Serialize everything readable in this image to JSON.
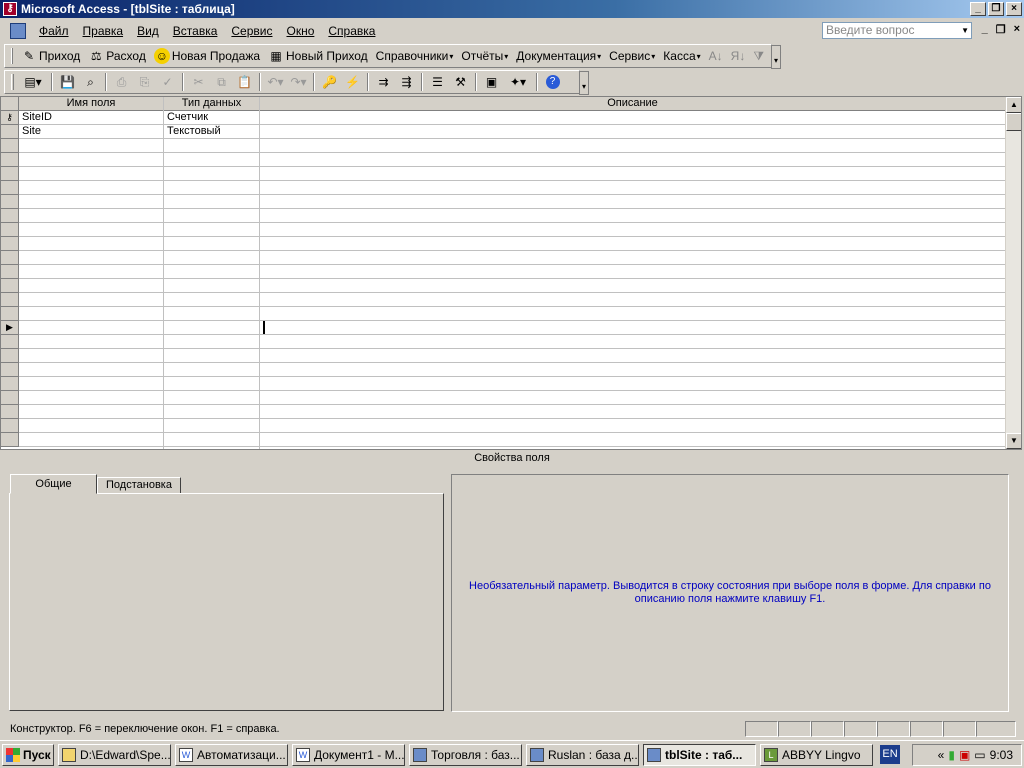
{
  "window": {
    "title": "Microsoft Access - [tblSite : таблица]",
    "app_icon": "access-key-icon"
  },
  "menubar": {
    "items": [
      "Файл",
      "Правка",
      "Вид",
      "Вставка",
      "Сервис",
      "Окно",
      "Справка"
    ],
    "ask_placeholder": "Введите вопрос"
  },
  "custom_toolbar": {
    "items": [
      {
        "label": "Приход",
        "icon": "receipt-icon"
      },
      {
        "label": "Расход",
        "icon": "scales-icon"
      },
      {
        "label": "Новая Продажа",
        "icon": "smiley-icon"
      },
      {
        "label": "Новый Приход",
        "icon": "form-icon"
      },
      {
        "label": "Справочники",
        "dropdown": true
      },
      {
        "label": "Отчёты",
        "dropdown": true
      },
      {
        "label": "Документация",
        "dropdown": true
      },
      {
        "label": "Сервис",
        "dropdown": true
      },
      {
        "label": "Касса",
        "dropdown": true
      }
    ]
  },
  "grid": {
    "headers": {
      "field_name": "Имя поля",
      "data_type": "Тип данных",
      "description": "Описание"
    },
    "rows": [
      {
        "name": "SiteID",
        "type": "Счетчик",
        "primary_key": true
      },
      {
        "name": "Site",
        "type": "Текстовый",
        "primary_key": false
      }
    ]
  },
  "properties": {
    "caption": "Свойства поля",
    "tabs": [
      "Общие",
      "Подстановка"
    ],
    "active_tab": "Общие",
    "help_text": "Необязательный параметр.  Выводится в строку состояния при выборе поля в форме.  Для справки по описанию поля нажмите клавишу F1."
  },
  "status_bar": {
    "text": "Конструктор.  F6 = переключение окон.  F1 = справка."
  },
  "taskbar": {
    "start_label": "Пуск",
    "tasks": [
      {
        "label": "D:\\Edward\\Spe...",
        "icon": "folder-icon"
      },
      {
        "label": "Автоматизаци...",
        "icon": "word-icon"
      },
      {
        "label": "Документ1 - М...",
        "icon": "word-icon"
      },
      {
        "label": "Торговля : баз...",
        "icon": "access-icon"
      },
      {
        "label": "Ruslan : база д...",
        "icon": "access-icon"
      },
      {
        "label": "tblSite : таб...",
        "icon": "table-icon",
        "active": true
      },
      {
        "label": "ABBYY Lingvo",
        "icon": "lingvo-icon"
      }
    ],
    "language": "EN",
    "clock": "9:03"
  }
}
